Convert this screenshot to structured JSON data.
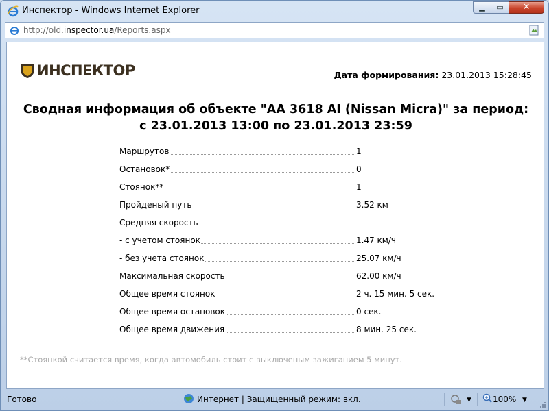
{
  "window": {
    "title": "Инспектор - Windows Internet Explorer"
  },
  "address": {
    "url_prefix": "http://old.",
    "url_domain": "inspector.ua",
    "url_path": "/Reports.aspx"
  },
  "report": {
    "logo_text": "ИНСПЕКТОР",
    "date_label": "Дата формирования:",
    "date_value": "23.01.2013 15:28:45",
    "heading_line1": "Сводная информация об объекте \"AA 3618 AI (Nissan Micra)\" за период:",
    "heading_line2": "с 23.01.2013 13:00 по 23.01.2013 23:59",
    "rows": [
      {
        "label": "Маршрутов",
        "value": "1"
      },
      {
        "label": "Остановок*",
        "value": "0"
      },
      {
        "label": "Стоянок**",
        "value": "1"
      },
      {
        "label": "Пройденый путь",
        "value": "3.52 км"
      },
      {
        "label": "Средняя скорость",
        "value": ""
      },
      {
        "label": "- с учетом стоянок",
        "value": "1.47 км/ч"
      },
      {
        "label": "- без учета стоянок",
        "value": "25.07 км/ч"
      },
      {
        "label": "Максимальная скорость",
        "value": "62.00 км/ч"
      },
      {
        "label": "Общее время стоянок",
        "value": "2 ч. 15 мин. 5 сек."
      },
      {
        "label": "Общее время остановок",
        "value": "0 сек."
      },
      {
        "label": "Общее время движения",
        "value": "8 мин. 25 сек."
      }
    ],
    "footnote": "**Стоянкой считается время, когда автомобиль стоит с выключеным зажиганием 5 минут."
  },
  "status": {
    "left": "Готово",
    "zone": "Интернет | Защищенный режим: вкл.",
    "zoom": "100%"
  }
}
